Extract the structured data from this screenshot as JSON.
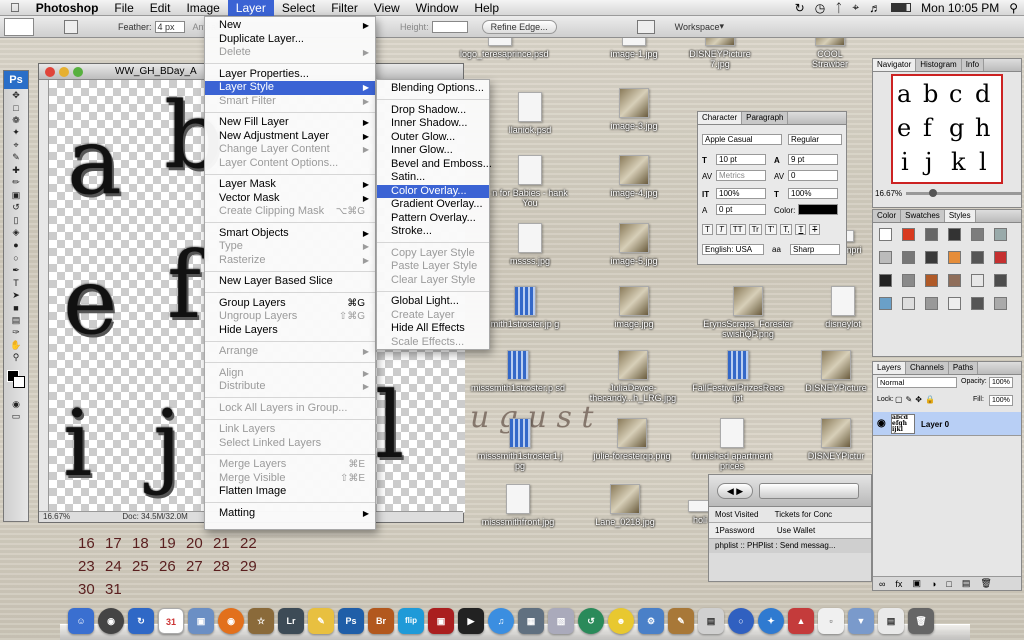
{
  "menubar": {
    "app": "Photoshop",
    "items": [
      "File",
      "Edit",
      "Image",
      "Layer",
      "Select",
      "Filter",
      "View",
      "Window",
      "Help"
    ],
    "active": "Layer",
    "clock": "Mon 10:05 PM"
  },
  "options_bar": {
    "feather_label": "Feather:",
    "feather_value": "4 px",
    "antialias_label": "Anti-ali",
    "height_label": "Height:",
    "refine_edge": "Refine Edge...",
    "workspace": "Workspace"
  },
  "document": {
    "title": "WW_GH_BDay_A",
    "zoom": "16.67%",
    "doc_size": "Doc: 34.5M/32.0M",
    "letters": [
      "a",
      "b",
      "e",
      "f",
      "i",
      "j",
      "l"
    ]
  },
  "layer_menu": [
    {
      "label": "New",
      "arrow": true
    },
    {
      "label": "Duplicate Layer..."
    },
    {
      "label": "Delete",
      "disabled": true,
      "arrow": true
    },
    {
      "sep": true
    },
    {
      "label": "Layer Properties..."
    },
    {
      "label": "Layer Style",
      "arrow": true,
      "highlight": true
    },
    {
      "label": "Smart Filter",
      "disabled": true,
      "arrow": true
    },
    {
      "sep": true
    },
    {
      "label": "New Fill Layer",
      "arrow": true
    },
    {
      "label": "New Adjustment Layer",
      "arrow": true
    },
    {
      "label": "Change Layer Content",
      "disabled": true,
      "arrow": true
    },
    {
      "label": "Layer Content Options...",
      "disabled": true
    },
    {
      "sep": true
    },
    {
      "label": "Layer Mask",
      "arrow": true
    },
    {
      "label": "Vector Mask",
      "arrow": true
    },
    {
      "label": "Create Clipping Mask",
      "disabled": true,
      "shortcut": "⌥⌘G"
    },
    {
      "sep": true
    },
    {
      "label": "Smart Objects",
      "arrow": true
    },
    {
      "label": "Type",
      "disabled": true,
      "arrow": true
    },
    {
      "label": "Rasterize",
      "disabled": true,
      "arrow": true
    },
    {
      "sep": true
    },
    {
      "label": "New Layer Based Slice"
    },
    {
      "sep": true
    },
    {
      "label": "Group Layers",
      "shortcut": "⌘G"
    },
    {
      "label": "Ungroup Layers",
      "disabled": true,
      "shortcut": "⇧⌘G"
    },
    {
      "label": "Hide Layers"
    },
    {
      "sep": true
    },
    {
      "label": "Arrange",
      "disabled": true,
      "arrow": true
    },
    {
      "sep": true
    },
    {
      "label": "Align",
      "disabled": true,
      "arrow": true
    },
    {
      "label": "Distribute",
      "disabled": true,
      "arrow": true
    },
    {
      "sep": true
    },
    {
      "label": "Lock All Layers in Group...",
      "disabled": true
    },
    {
      "sep": true
    },
    {
      "label": "Link Layers",
      "disabled": true
    },
    {
      "label": "Select Linked Layers",
      "disabled": true
    },
    {
      "sep": true
    },
    {
      "label": "Merge Layers",
      "disabled": true,
      "shortcut": "⌘E"
    },
    {
      "label": "Merge Visible",
      "disabled": true,
      "shortcut": "⇧⌘E"
    },
    {
      "label": "Flatten Image"
    },
    {
      "sep": true
    },
    {
      "label": "Matting",
      "arrow": true
    }
  ],
  "style_submenu": [
    {
      "label": "Blending Options..."
    },
    {
      "sep": true
    },
    {
      "label": "Drop Shadow..."
    },
    {
      "label": "Inner Shadow..."
    },
    {
      "label": "Outer Glow..."
    },
    {
      "label": "Inner Glow..."
    },
    {
      "label": "Bevel and Emboss..."
    },
    {
      "label": "Satin..."
    },
    {
      "label": "Color Overlay...",
      "highlight": true
    },
    {
      "label": "Gradient Overlay..."
    },
    {
      "label": "Pattern Overlay..."
    },
    {
      "label": "Stroke..."
    },
    {
      "sep": true
    },
    {
      "label": "Copy Layer Style",
      "disabled": true
    },
    {
      "label": "Paste Layer Style",
      "disabled": true
    },
    {
      "label": "Clear Layer Style",
      "disabled": true
    },
    {
      "sep": true
    },
    {
      "label": "Global Light..."
    },
    {
      "label": "Create Layer",
      "disabled": true
    },
    {
      "label": "Hide All Effects"
    },
    {
      "label": "Scale Effects...",
      "disabled": true
    }
  ],
  "desktop_icons": [
    "logo_teresaprince.psd",
    "image-1.jpg",
    "DISNEYPicture 7.jpg",
    "COOL Strawber",
    "llaniok.psd",
    "image-3.jpg",
    "n for Babies - hank You",
    "image-4.jpg",
    "mssss.jpg",
    "image-5.jpg",
    "custompri",
    "mith1stroster.jp g",
    "image.jpg",
    "ErynsScraps_Forester swishQP.png",
    "disneylot",
    "misssmith1stroster.p sd",
    "JuliaDevoe-thecandy...h_LRG.jpg",
    "FallFestivalPrizesRece ipt",
    "DISNEYPicture",
    "misssmith1stroster1.j pg",
    "julie-foresterqp.png",
    "furnished apartment prices",
    "DISNEYPictur",
    "misssmithfront.jpg",
    "Lane_0218.jpg",
    "holi"
  ],
  "character_panel": {
    "tabs": [
      "Character",
      "Paragraph"
    ],
    "font": "Apple Casual",
    "style": "Regular",
    "size": "10 pt",
    "leading": "9 pt",
    "kerning": "Metrics",
    "tracking": "0",
    "vscale": "100%",
    "hscale": "100%",
    "baseline": "0 pt",
    "color_label": "Color:",
    "type_styles": [
      "T",
      "T",
      "TT",
      "Tr",
      "T'",
      "T,",
      "T",
      "T"
    ],
    "language": "English: USA",
    "aa_label": "a",
    "aa_value": "Sharp"
  },
  "navigator_panel": {
    "tabs": [
      "Navigator",
      "Histogram",
      "Info"
    ],
    "zoom": "16.67%",
    "preview": [
      "a",
      "b",
      "c",
      "d",
      "e",
      "f",
      "g",
      "h",
      "i",
      "j",
      "k",
      "l"
    ]
  },
  "styles_panel": {
    "tabs": [
      "Color",
      "Swatches",
      "Styles"
    ]
  },
  "layers_panel": {
    "tabs": [
      "Layers",
      "Channels",
      "Paths"
    ],
    "blend_mode": "Normal",
    "opacity_label": "Opacity:",
    "opacity": "100%",
    "lock_label": "Lock:",
    "fill_label": "Fill:",
    "fill": "100%",
    "layer_name": "Layer 0"
  },
  "browser": {
    "most_visited": "Most Visited",
    "tickets": "Tickets for Conc",
    "onepassword": "1Password",
    "use_wallet": "Use Wallet",
    "tab": "phplist :: PHPlist : Send messag..."
  },
  "calendar": {
    "rows": [
      [
        "16",
        "17",
        "18",
        "19",
        "20",
        "21",
        "22"
      ],
      [
        "23",
        "24",
        "25",
        "26",
        "27",
        "28",
        "29"
      ],
      [
        "30",
        "31"
      ]
    ]
  },
  "dock": {
    "labels": [
      "31",
      "Lr",
      "Ps",
      "Br",
      "flip"
    ]
  }
}
